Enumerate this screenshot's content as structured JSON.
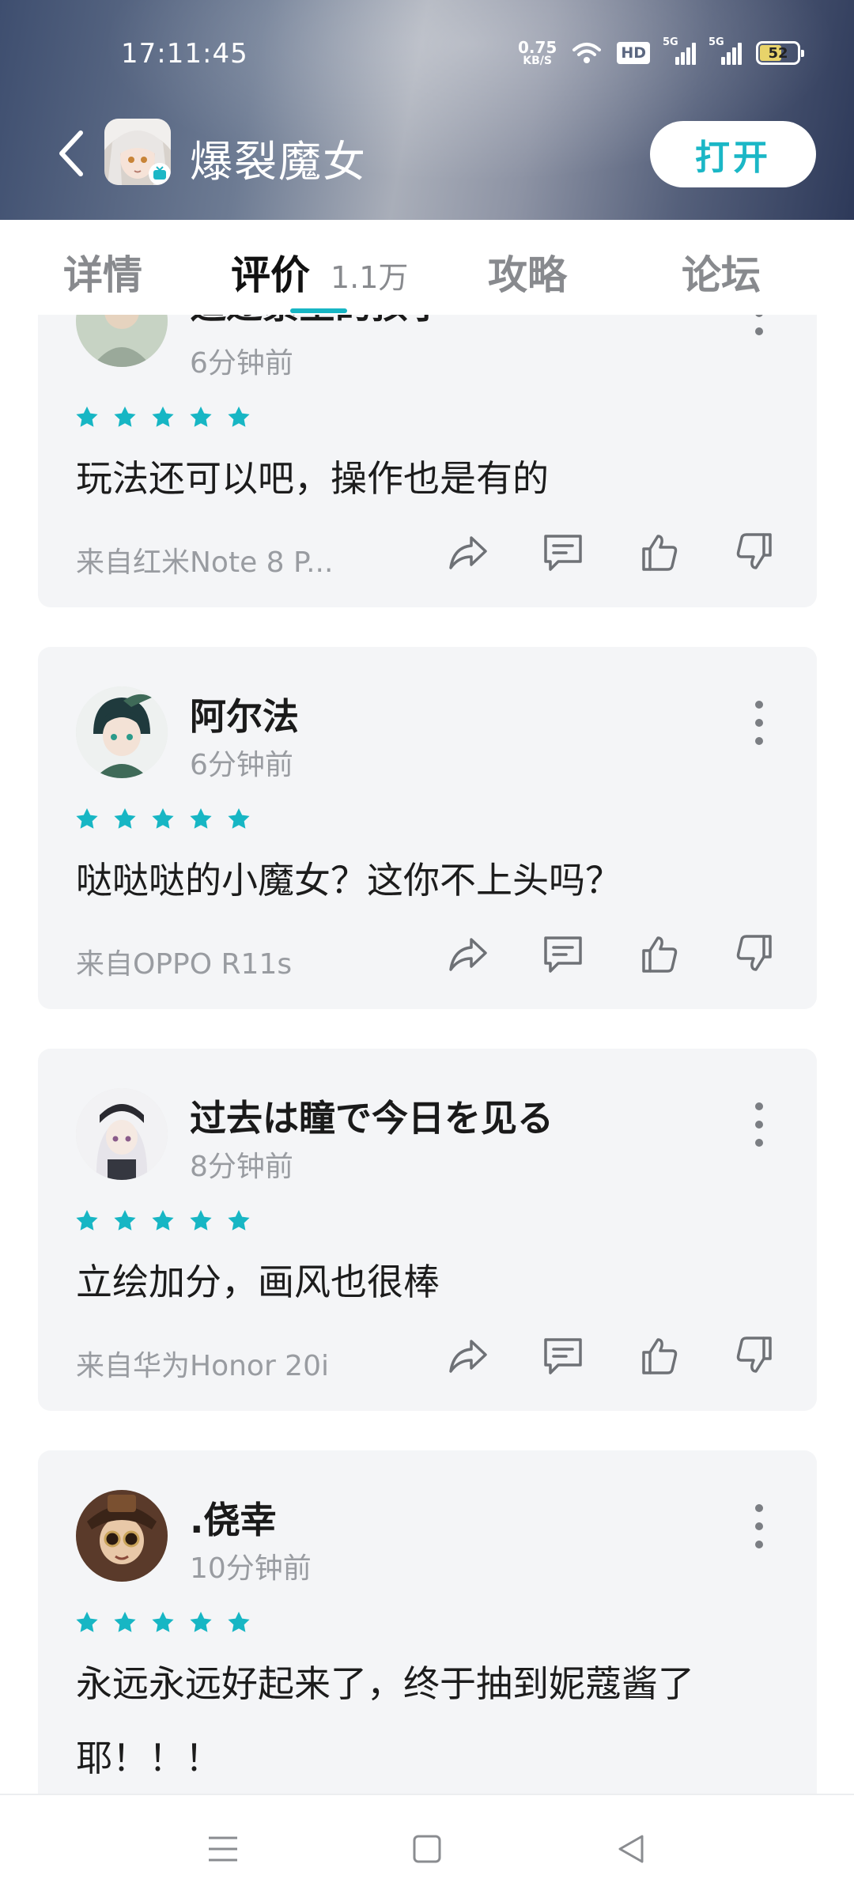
{
  "status_bar": {
    "time": "17:11:45",
    "net_speed_value": "0.75",
    "net_speed_unit": "KB/S",
    "hd_label": "HD",
    "sim1_label": "5G",
    "sim2_label": "5G",
    "battery_level": "52"
  },
  "app_bar": {
    "title": "爆裂魔女",
    "open_button": "打开"
  },
  "tabs": [
    {
      "label": "详情",
      "active": false
    },
    {
      "label": "评价",
      "active": true,
      "count": "1.1万"
    },
    {
      "label": "攻略",
      "active": false
    },
    {
      "label": "论坛",
      "active": false
    }
  ],
  "reviews": [
    {
      "username": "追逐繁星的孩子",
      "time": "6分钟前",
      "rating": 5,
      "content": "玩法还可以吧，操作也是有的",
      "device": "来自红米Note 8 P..."
    },
    {
      "username": "阿尔法",
      "time": "6分钟前",
      "rating": 5,
      "content": "哒哒哒的小魔女？这你不上头吗？",
      "device": "来自OPPO R11s"
    },
    {
      "username": "过去は瞳で今日を见る",
      "time": "8分钟前",
      "rating": 5,
      "content": "立绘加分，画风也很棒",
      "device": "来自华为Honor 20i"
    },
    {
      "username": ".侥幸",
      "time": "10分钟前",
      "rating": 5,
      "content": "永远永远好起来了，终于抽到妮蔻酱了耶！！！",
      "device": ""
    }
  ],
  "colors": {
    "accent": "#17b6c4",
    "card_bg": "#f4f5f7",
    "muted_text": "#999ca1"
  },
  "icons": {
    "back": "chevron-left-icon",
    "share": "share-icon",
    "comment": "comment-icon",
    "like": "thumbs-up-icon",
    "dislike": "thumbs-down-icon",
    "more": "more-vertical-icon",
    "star": "star-icon",
    "nav_menu": "menu-icon",
    "nav_home": "square-home-icon",
    "nav_back": "triangle-back-icon"
  }
}
